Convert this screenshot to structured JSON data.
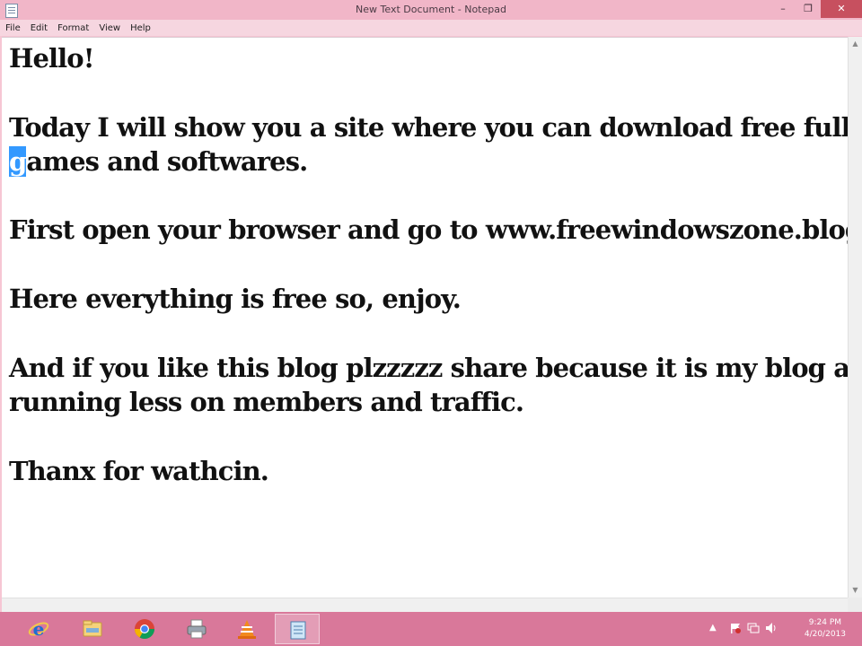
{
  "window": {
    "title": "New Text Document - Notepad",
    "controls": {
      "minimize": "–",
      "maximize": "❐",
      "close": "✕"
    }
  },
  "menu": {
    "items": [
      "File",
      "Edit",
      "Format",
      "View",
      "Help"
    ]
  },
  "document": {
    "lines": [
      "Hello!",
      "",
      "Today I will show you a site where you can download free full version",
      {
        "selected": "g",
        "rest": "ames and softwares."
      },
      "",
      "First open your browser and go to www.freewindowszone.blogspot.com",
      "",
      "Here everything is free so, enjoy.",
      "",
      "And if you like this blog plzzzzz share because it is my blog and I'm",
      "running less on members and traffic.",
      "",
      "Thanx for wathcin."
    ]
  },
  "taskbar": {
    "apps": [
      {
        "name": "internet-explorer-icon",
        "active": false
      },
      {
        "name": "file-explorer-icon",
        "active": false
      },
      {
        "name": "chrome-icon",
        "active": false
      },
      {
        "name": "printer-icon",
        "active": false
      },
      {
        "name": "vlc-icon",
        "active": false
      },
      {
        "name": "notepad-icon",
        "active": true
      }
    ],
    "tray": {
      "show_hidden": "▲",
      "time": "9:24 PM",
      "date": "4/20/2013"
    }
  },
  "colors": {
    "accent": "#e88aa8",
    "titlebar": "#f1b6c8",
    "close_button": "#c7505f",
    "selection": "#3399ff"
  }
}
